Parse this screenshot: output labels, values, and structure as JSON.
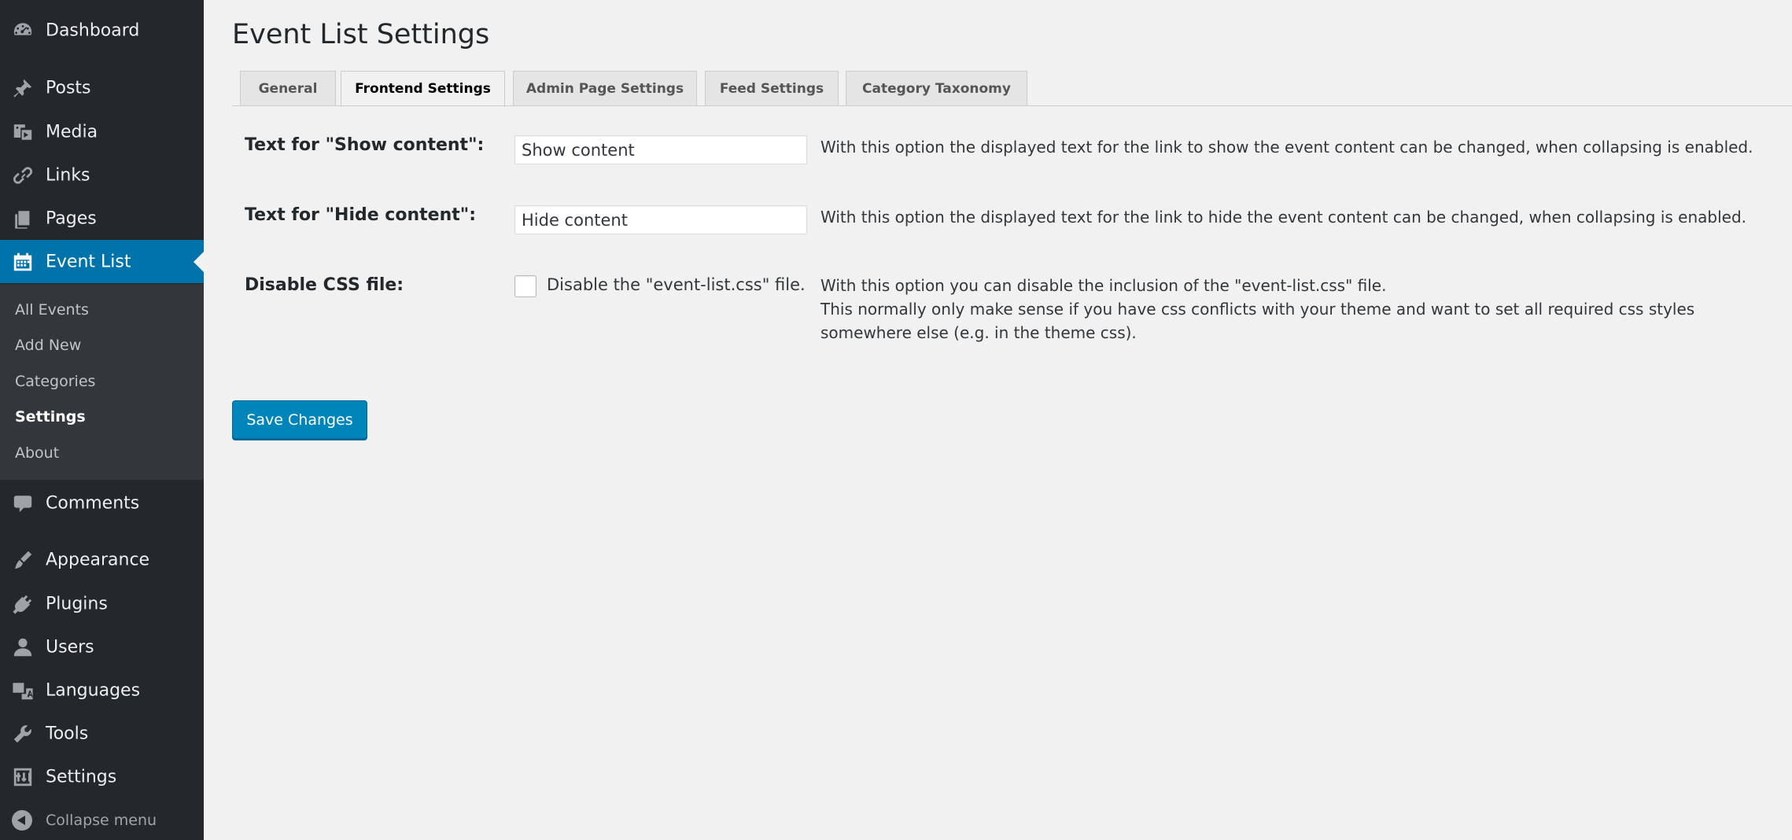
{
  "sidebar": {
    "items": [
      {
        "label": "Dashboard",
        "icon": "dashboard-icon"
      },
      {
        "label": "Posts",
        "icon": "pushpin-icon"
      },
      {
        "label": "Media",
        "icon": "media-icon"
      },
      {
        "label": "Links",
        "icon": "link-icon"
      },
      {
        "label": "Pages",
        "icon": "pages-icon"
      },
      {
        "label": "Event List",
        "icon": "calendar-icon",
        "active": true
      },
      {
        "label": "Comments",
        "icon": "comment-icon"
      },
      {
        "label": "Appearance",
        "icon": "paintbrush-icon"
      },
      {
        "label": "Plugins",
        "icon": "plugin-icon"
      },
      {
        "label": "Users",
        "icon": "user-icon"
      },
      {
        "label": "Languages",
        "icon": "translation-icon"
      },
      {
        "label": "Tools",
        "icon": "wrench-icon"
      },
      {
        "label": "Settings",
        "icon": "sliders-icon"
      }
    ],
    "submenu": [
      "All Events",
      "Add New",
      "Categories",
      "Settings",
      "About"
    ],
    "submenu_current": "Settings",
    "collapse_label": "Collapse menu"
  },
  "page": {
    "title": "Event List Settings",
    "tabs": [
      "General",
      "Frontend Settings",
      "Admin Page Settings",
      "Feed Settings",
      "Category Taxonomy"
    ],
    "active_tab": "Frontend Settings"
  },
  "fields": {
    "show_content": {
      "label": "Text for \"Show content\":",
      "value": "Show content",
      "description": "With this option the displayed text for the link to show the event content can be changed, when collapsing is enabled."
    },
    "hide_content": {
      "label": "Text for \"Hide content\":",
      "value": "Hide content",
      "description": "With this option the displayed text for the link to hide the event content can be changed, when collapsing is enabled."
    },
    "disable_css": {
      "label": "Disable CSS file:",
      "checkbox_label": "Disable the \"event-list.css\" file.",
      "checked": false,
      "description_lines": [
        "With this option you can disable the inclusion of the \"event-list.css\" file.",
        "This normally only make sense if you have css conflicts with your theme and want to set all required css styles",
        "somewhere else (e.g. in the theme css)."
      ]
    }
  },
  "actions": {
    "save_label": "Save Changes"
  },
  "colors": {
    "sidebar_bg": "#23282d",
    "submenu_bg": "#32373c",
    "active_bg": "#0073aa",
    "primary_button": "#0085ba",
    "page_bg": "#f1f1f1"
  }
}
